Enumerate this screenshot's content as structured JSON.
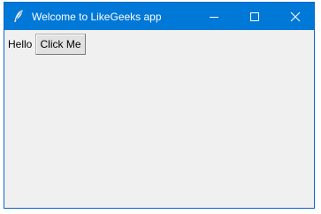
{
  "window": {
    "title": "Welcome to LikeGeeks app",
    "icon": "feather-icon",
    "controls": [
      "minimize-icon",
      "maximize-icon",
      "close-icon"
    ],
    "accent_color": "#0078d7",
    "background_color": "#f0f0f0"
  },
  "content": {
    "label_text": "Hello",
    "button_label": "Click Me"
  }
}
